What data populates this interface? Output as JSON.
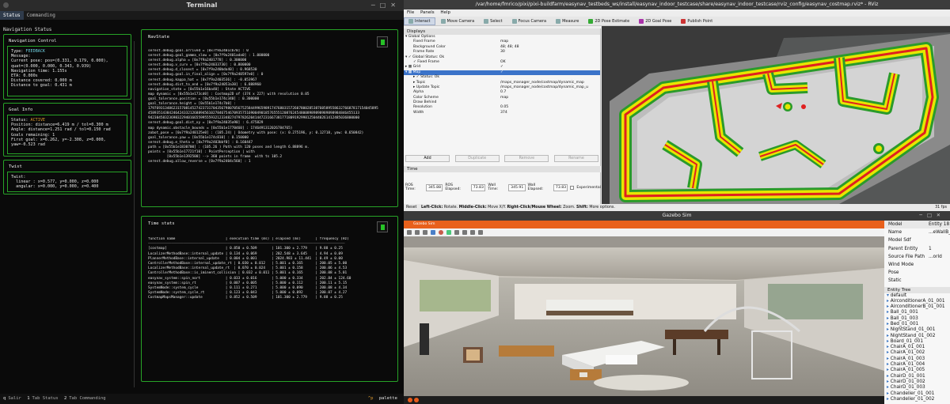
{
  "terminal": {
    "title": "Terminal",
    "tabs": [
      "Status",
      "Commanding"
    ],
    "heading": "Navigation Status",
    "nav_control": {
      "title": "Navigation Control",
      "type_label": "Type:",
      "type_value": "FEEDBACK",
      "message": "Message:",
      "current_pose": "Current pose: pos=(0.331, 0.179, 0.000),",
      "quat": "quat=(0.000, 0.000, 0.343, 0.939)",
      "nav_time": "Navigation time: 1.155s",
      "eta": "ETA: 0.000s",
      "distance_covered": "Distance covered: 0.000 m",
      "distance_goal": "Distance to goal: 0.431 m"
    },
    "goal_info": {
      "title": "Goal Info",
      "status_label": "Status:",
      "status_value": "ACTIVE",
      "position": "Position: distance=6.419 m / tol=0.300 m",
      "angle": "Angle: distance=1.251 rad / tol=0.150 rad",
      "goals": "Goals remaining: 1",
      "first_goal": "First goal: x=6.262, y=-2.308, z=0.000, yaw=-0.523 rad"
    },
    "twist": {
      "title": "Twist",
      "header": "Twist:",
      "linear": "  linear : x=0.577, y=0.000, z=0.000",
      "angular": "  angular: x=0.000, y=0.000, z=0.400"
    },
    "navstate": {
      "title": "NavState",
      "lines": [
        "serest.debug.goal.arrived = [0x7f9a2401cb70] : 0",
        "serest.debug.goal_gamma_slow = [0x7f9a2401ada0] : 1.000000",
        "serest.debug.alpha = [0x7f9a2401778] : 0.300000",
        "serest.debug.v_curv = [0x7f9a24033730] : 0.800000",
        "serest.debug.d_closest = [0x7f9a240bda40] : 0.968530",
        "serest.debug.goal.in_final_align = [0x7f9a240597e0] : 0",
        "serest.debug.kappa_hat = [0x7f9a2403536] : -0.053967",
        "serest.debug.dist_to_end = [0x7f9a24053a30] : 6.888960",
        "navigation_state = [0x55b1e16ba40] : State ACTIVE",
        "",
        "map dynamic = [0x55b1e173cd0] : Costmap2D of (374 x 227) with resolution 0.05",
        "goal_tolerance.position = [0x55b1e174c340] : 0.300000",
        "goal_tolerance.height = [0x55b1e174c7b0] :",
        "17976931348623157081452742373170435679807056752584499659891747680315726078002853876058955863276687817154045895",
        "45893514384246424332126889456102784675467093575169004901857655512087624548008989898989898984846455133",
        "94230458323698322940166559955593212334827479782620414472316673817718091929981250440261412485036800000",
        "",
        "serest.debug.goal.dist_xy = [0x7f9a24035a90] : 6.475829",
        "map dynamic.obstacle_bounds = [0x55b1e1770460] : 1746491312026784765)",
        "zobot_pose = [0x7f9a240125e0] : (105.24) | Odometry with pose: (x: 0.275196, y: 0.12718, yaw: 0.650842)",
        "goal_tolerance.yaw = [0x55b1e174c810] : 0.150000",
        "serest.debug.e_theta = [0x7f9a2403bbf0] : 0.160447",
        "path = [0x55b1e1830700] : (105.26 ) Path with 120 poses and length 6.88896 m.",
        "points = [0x55b1e17721f10] : PointPerception | with",
        "         [0x55b1e1392500] --> 360 points in frame  with ts 105.2",
        "",
        "serest.debug.allow_reverse = [0x7f9a2404c560] : 1"
      ]
    },
    "timestats": {
      "title": "Time stats",
      "header": "function name                        | execution time (ms) | elapsed (ms)       | frequency (Hz)",
      "rows": [
        "[costmap]                            | 0.850 ± 0.509       | 101.300 ± 2.779    | 9.88 ± 0.25",
        "LocalizerMethodBase::internal_update | 0.134 ± 0.069       | 202.548 ± 3.645    | 4.94 ± 0.09",
        "PlannerMethodBase::internal_update   | 0.004 ± 0.001       | 2024.983 ± 11.441  | 0.49 ± 0.00",
        "ControllerMethodBase::internal_update_rt | 0.030 ± 0.012   | 5.001 ± 0.165      | 200.05 ± 5.00",
        "LocalizerMethodBase::internal_update_rt  | 0.070 ± 0.024   | 5.001 ± 0.158      | 200.06 ± 4.53",
        "ControllerMethodBase::is_iminent_collision | 0.032 ± 0.011 | 5.001 ± 0.165      | 200.08 ± 5.01",
        "easynav_system::spin_nort            | 0.033 ± 0.016       | 5.000 ± 0.334      | 202.84 ± 124.60",
        "easynav_system::spin_rt              | 0.007 ± 0.005       | 5.000 ± 0.112      | 200.11 ± 5.15",
        "SystemNode::system_cycle             | 0.111 ± 0.271       | 5.000 ± 0.090      | 200.08 ± 4.34",
        "SystemNode::system_cycle_rt          | 0.123 ± 0.043       | 5.000 ± 0.092      | 200.07 ± 4.27",
        "CostmapMapsManager::update           | 0.852 ± 0.509       | 101.300 ± 2.779    | 9.88 ± 0.25"
      ]
    },
    "bottom": {
      "q": "q",
      "quit": "Salir",
      "k1": "1",
      "tab1": "Tab Status",
      "k2": "2",
      "tab2": "Tab Commanding",
      "palette_key": "^p",
      "palette": "palette"
    }
  },
  "rviz": {
    "title": "/var/home/fmrico/pixi/pixi-buildfarm/easynav_testbeds_ws/install/easynav_indoor_testcase/share/easynav_indoor_testcase/rviz_config/easynav_costmap.rviz* - RViz",
    "menu": [
      "File",
      "Panels",
      "Help"
    ],
    "tools": [
      "Interact",
      "Move Camera",
      "Select",
      "Focus Camera",
      "Measure",
      "2D Pose Estimate",
      "2D Goal Pose",
      "Publish Point"
    ],
    "displays_title": "Displays",
    "display_rows": [
      {
        "indent": 2,
        "key": "▾ Global Options",
        "val": ""
      },
      {
        "indent": 12,
        "key": "Fixed Frame",
        "val": "map"
      },
      {
        "indent": 12,
        "key": "Background Color",
        "val": "48; 48; 48"
      },
      {
        "indent": 12,
        "key": "Frame Rate",
        "val": "30"
      },
      {
        "indent": 2,
        "key": "▾ ✓ Global Status: Ok",
        "val": ""
      },
      {
        "indent": 12,
        "key": "✓ Fixed Frame",
        "val": "OK"
      },
      {
        "indent": 2,
        "key": "▸ ▦ Grid",
        "val": "✓"
      },
      {
        "indent": 2,
        "key": "▾ ▦ Map",
        "val": "✓"
      },
      {
        "indent": 12,
        "key": "▸ ✓ Status: Ok",
        "val": ""
      },
      {
        "indent": 12,
        "key": "▸ Topic",
        "val": "/maps_manager_node/costmap/dynamic_map"
      },
      {
        "indent": 12,
        "key": "▸ Update Topic",
        "val": "/maps_manager_node/costmap/dynamic_map_u"
      },
      {
        "indent": 12,
        "key": "Alpha",
        "val": "0.7"
      },
      {
        "indent": 12,
        "key": "Color Scheme",
        "val": "map"
      },
      {
        "indent": 12,
        "key": "Draw Behind",
        "val": ""
      },
      {
        "indent": 12,
        "key": "Resolution",
        "val": "0.05"
      },
      {
        "indent": 12,
        "key": "Width",
        "val": "374"
      }
    ],
    "buttons": [
      "Add",
      "Duplicate",
      "Remove",
      "Rename"
    ],
    "time_title": "Time",
    "time": {
      "ros_time_label": "ROS Time:",
      "ros_time": "345.88",
      "ros_elapsed_label": "ROS Elapsed:",
      "ros_elapsed": "73.83",
      "wall_time_label": "Wall Time:",
      "wall_time": "345.91",
      "wall_elapsed_label": "Wall Elapsed:",
      "wall_elapsed": "73.83",
      "experimental": "Experimental"
    },
    "status": {
      "reset": "Reset",
      "left": "Left-Click:",
      "left_v": "Rotate.",
      "middle": "Middle-Click:",
      "middle_v": "Move X/Y.",
      "right": "Right-Click/Mouse Wheel:",
      "right_v": "Zoom.",
      "shift": "Shift:",
      "shift_v": "More options.",
      "fps": "31 fps"
    }
  },
  "gazebo": {
    "title": "Gazebo Sim",
    "menu_label": "Gazebo Sim",
    "props": [
      {
        "k": "Model",
        "v": "Entity 18"
      },
      {
        "k": "Name",
        "v": "...eWallB_01_001"
      },
      {
        "k": "Model Sdf",
        "v": ""
      },
      {
        "k": "Parent Entity",
        "v": "1"
      },
      {
        "k": "Source File Path",
        "v": "...orld"
      },
      {
        "k": "Wind Mode",
        "v": ""
      },
      {
        "k": "Pose",
        "v": ""
      },
      {
        "k": "Static",
        "v": ""
      }
    ],
    "entity_tree_title": "Entity Tree",
    "entities": [
      "default",
      "AirconditionerA_01_001",
      "AirconditionerB_01_001",
      "Ball_01_001",
      "Ball_01_003",
      "Bed_01_001",
      "NightStand_01_001",
      "NightStand_01_002",
      "Board_01_001",
      "ChairA_01_001",
      "ChairA_01_002",
      "ChairA_01_003",
      "ChairA_01_004",
      "ChairA_01_005",
      "ChairD_01_001",
      "ChairD_01_002",
      "ChairD_01_003",
      "Chandelier_01_001",
      "Chandelier_01_002"
    ]
  },
  "colors": {
    "terminal_border": "#27a327",
    "costmap_yellow": "#e6e600",
    "costmap_red": "#e02020",
    "costmap_green": "#1f8f1f",
    "gazebo_orange": "#e8601c",
    "rviz_selection": "#3b73c9"
  }
}
